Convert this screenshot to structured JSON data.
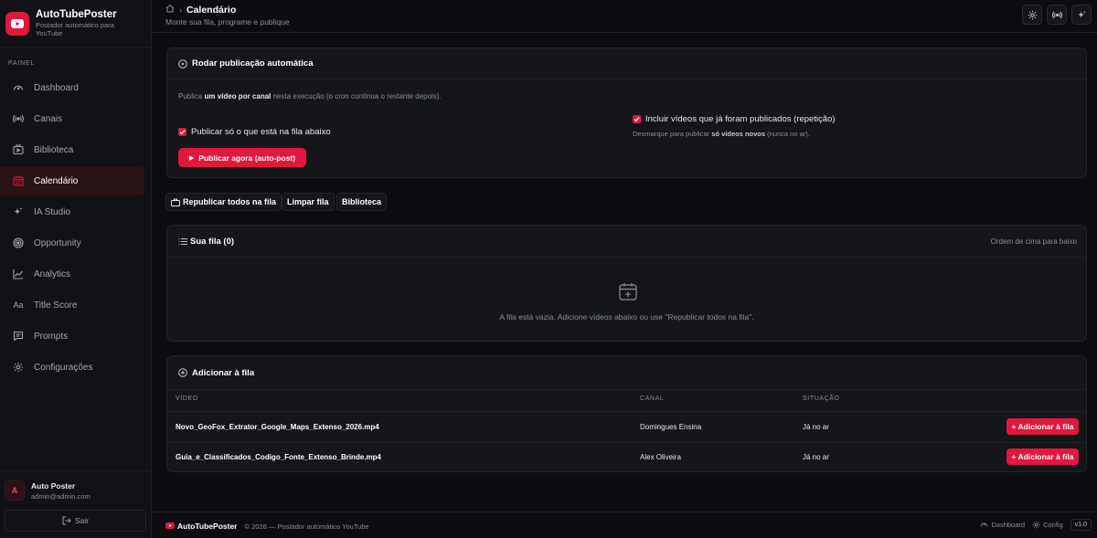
{
  "brand": {
    "title": "AutoTubePoster",
    "subtitle": "Postador automático para YouTube"
  },
  "sidebar": {
    "section": "PAINEL",
    "items": [
      {
        "label": "Dashboard",
        "icon": "gauge-icon"
      },
      {
        "label": "Canais",
        "icon": "broadcast-icon"
      },
      {
        "label": "Biblioteca",
        "icon": "video-library-icon"
      },
      {
        "label": "Calendário",
        "icon": "calendar-icon",
        "active": true
      },
      {
        "label": "IA Studio",
        "icon": "sparkles-icon"
      },
      {
        "label": "Opportunity",
        "icon": "target-icon"
      },
      {
        "label": "Analytics",
        "icon": "line-chart-icon"
      },
      {
        "label": "Title Score",
        "icon": "text-aa-icon"
      },
      {
        "label": "Prompts",
        "icon": "message-icon"
      },
      {
        "label": "Configurações",
        "icon": "gear-icon"
      }
    ]
  },
  "user": {
    "initial": "A",
    "name": "Auto Poster",
    "email": "admin@admin.com",
    "logout": "Sair"
  },
  "header": {
    "title": "Calendário",
    "subtitle": "Monte sua fila, programe e publique"
  },
  "autopost": {
    "title": "Rodar publicação automática",
    "desc_pre": "Publica ",
    "desc_bold": "um vídeo por canal",
    "desc_post": " nesta execução (o cron continua o restante depois).",
    "only_queue_label": "Publicar só o que está na fila abaixo",
    "include_label": "Incluir vídeos que já foram publicados (repetição)",
    "hint_pre": "Desmarque para publicar ",
    "hint_bold": "só vídeos novos",
    "hint_post": " (nunca no ar).",
    "publish_button": "Publicar agora (auto-post)"
  },
  "actions": {
    "republish_all": "Republicar todos na fila",
    "clear_queue": "Limpar fila",
    "library": "Biblioteca"
  },
  "queue": {
    "title": "Sua fila (0)",
    "order_hint": "Ordem de cima para baixo",
    "empty_text": "A fila está vazia. Adicione vídeos abaixo ou use \"Republicar todos na fila\"."
  },
  "add": {
    "title": "Adicionar à fila",
    "columns": [
      "VÍDEO",
      "CANAL",
      "SITUAÇÃO"
    ],
    "rows": [
      {
        "video": "Novo_GeoFox_Extrator_Google_Maps_Extenso_2026.mp4",
        "channel": "Domingues Ensina",
        "status": "Já no ar",
        "button": "+ Adicionar à fila"
      },
      {
        "video": "Guia_e_Classificados_Codigo_Fonte_Extenso_Brinde.mp4",
        "channel": "Alex Oliveira",
        "status": "Já no ar",
        "button": "+ Adicionar à fila"
      }
    ]
  },
  "footer": {
    "brand": "AutoTubePoster",
    "copy": "© 2026 — Postador automático YouTube",
    "dashboard": "Dashboard",
    "config": "Config",
    "version": "v1.0"
  },
  "colors": {
    "accent": "#e0183d",
    "background": "#0c0d10",
    "surface": "#15161a"
  }
}
